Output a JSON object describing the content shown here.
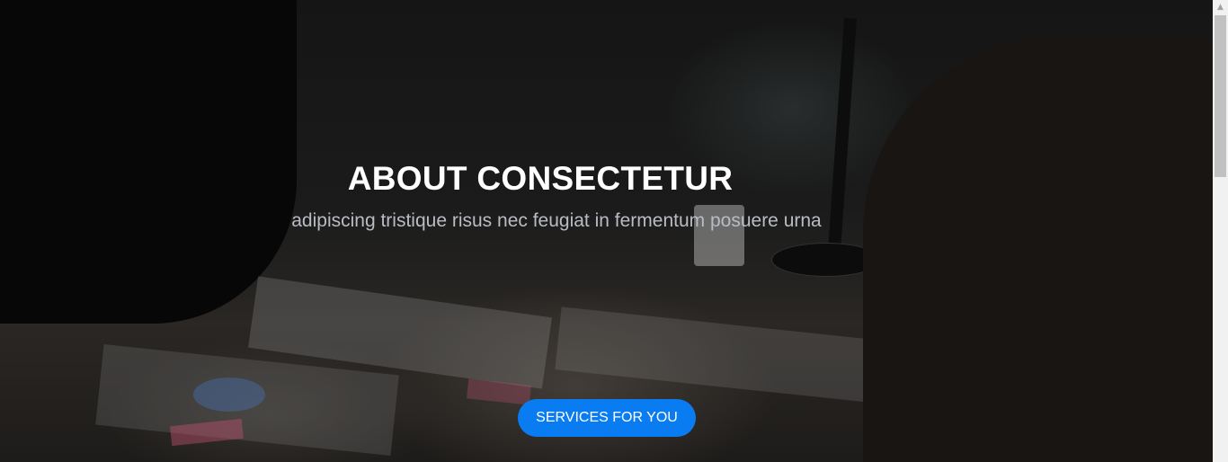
{
  "hero": {
    "title": "ABOUT CONSECTETUR",
    "subtitle": "adipiscing tristique risus nec feugiat in fermentum posuere urna",
    "cta_label": "SERVICES FOR YOU"
  },
  "colors": {
    "accent": "#0a7cf2",
    "title": "#ffffff",
    "subtitle": "#b9bcc3"
  }
}
